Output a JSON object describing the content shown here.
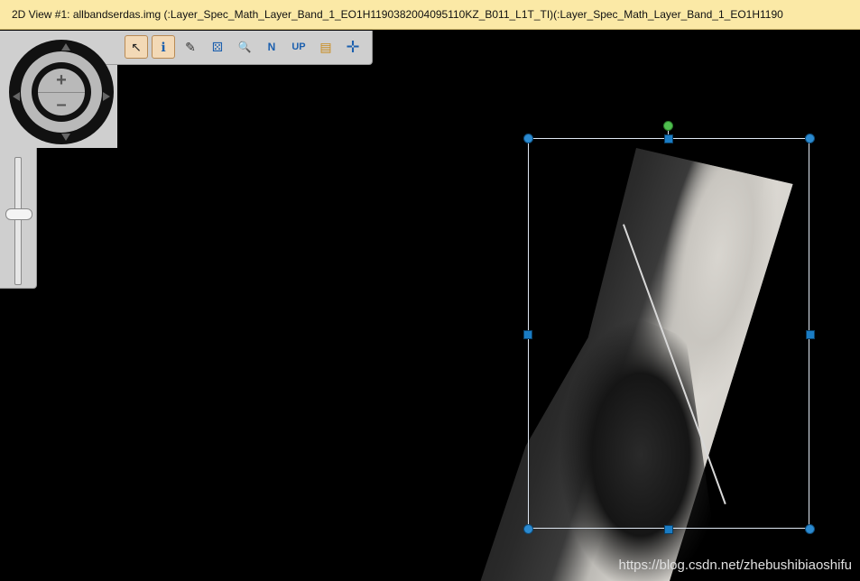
{
  "window": {
    "title": "2D View #1: allbandserdas.img (:Layer_Spec_Math_Layer_Band_1_EO1H1190382004095110KZ_B011_L1T_TI)(:Layer_Spec_Math_Layer_Band_1_EO1H1190"
  },
  "toolbar": {
    "tools": [
      {
        "name": "select-tool",
        "icon": "arrow-pointer-icon",
        "glyph": "↖",
        "active": true
      },
      {
        "name": "inquire-tool",
        "icon": "info-icon",
        "glyph": "ℹ",
        "active": true
      },
      {
        "name": "roam-tool",
        "icon": "brush-icon",
        "glyph": "✎",
        "active": false
      },
      {
        "name": "zoom-extent-tool",
        "icon": "dice-icon",
        "glyph": "⚄",
        "active": false
      },
      {
        "name": "magnify-tool",
        "icon": "magnifier-icon",
        "glyph": "🔍",
        "active": false
      },
      {
        "name": "north-up-tool",
        "icon": "north-icon",
        "glyph": "N",
        "active": false
      },
      {
        "name": "up-tool",
        "icon": "up-icon",
        "glyph": "UP",
        "active": false
      },
      {
        "name": "layers-tool",
        "icon": "layers-icon",
        "glyph": "▤",
        "active": false
      },
      {
        "name": "crosshair-tool",
        "icon": "crosshair-icon",
        "glyph": "✛",
        "active": false
      }
    ]
  },
  "navigator": {
    "zoom_in_label": "+",
    "zoom_out_label": "–"
  },
  "watermark": "https://blog.csdn.net/zhebushibiaoshifu"
}
